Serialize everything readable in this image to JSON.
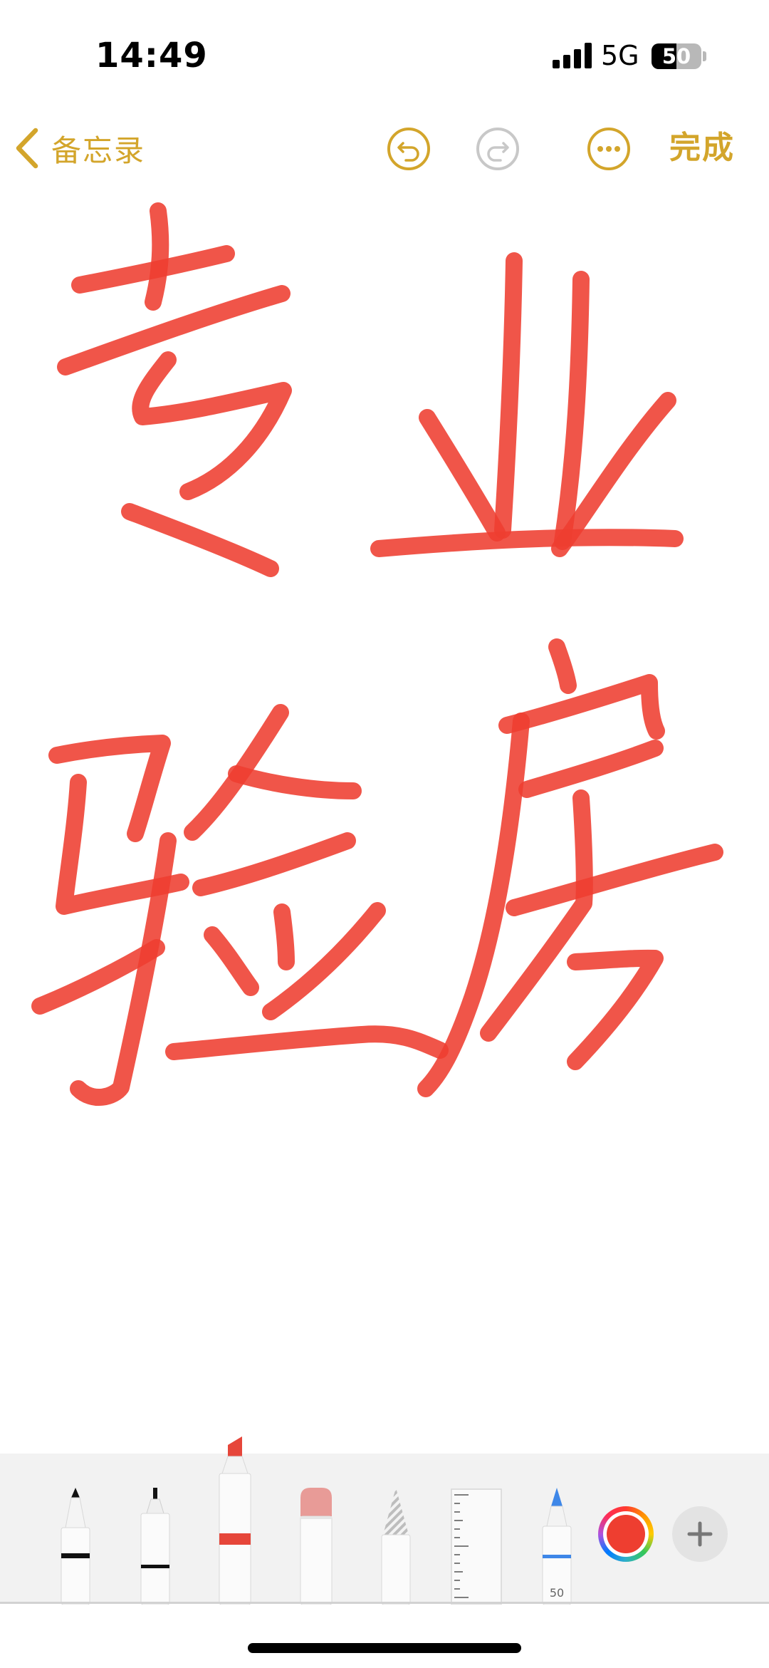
{
  "status_bar": {
    "time": "14:49",
    "network": "5G",
    "battery_percent": "50",
    "battery_level": 0.5
  },
  "nav": {
    "back_label": "备忘录",
    "done_label": "完成",
    "back_icon": "chevron-left-icon",
    "undo_icon": "undo-icon",
    "redo_icon": "redo-icon",
    "more_icon": "ellipsis-circle-icon"
  },
  "palette": {
    "tools": [
      "pen",
      "monoline",
      "marker",
      "eraser",
      "pencil",
      "ruler",
      "fountain-pen"
    ],
    "selected_tool": "marker",
    "fountain_pen_width": "50",
    "current_color": "#ee3e30",
    "add_icon": "plus-icon"
  },
  "colors": {
    "accent": "#d3a52b",
    "ink": "#ee3e30"
  }
}
